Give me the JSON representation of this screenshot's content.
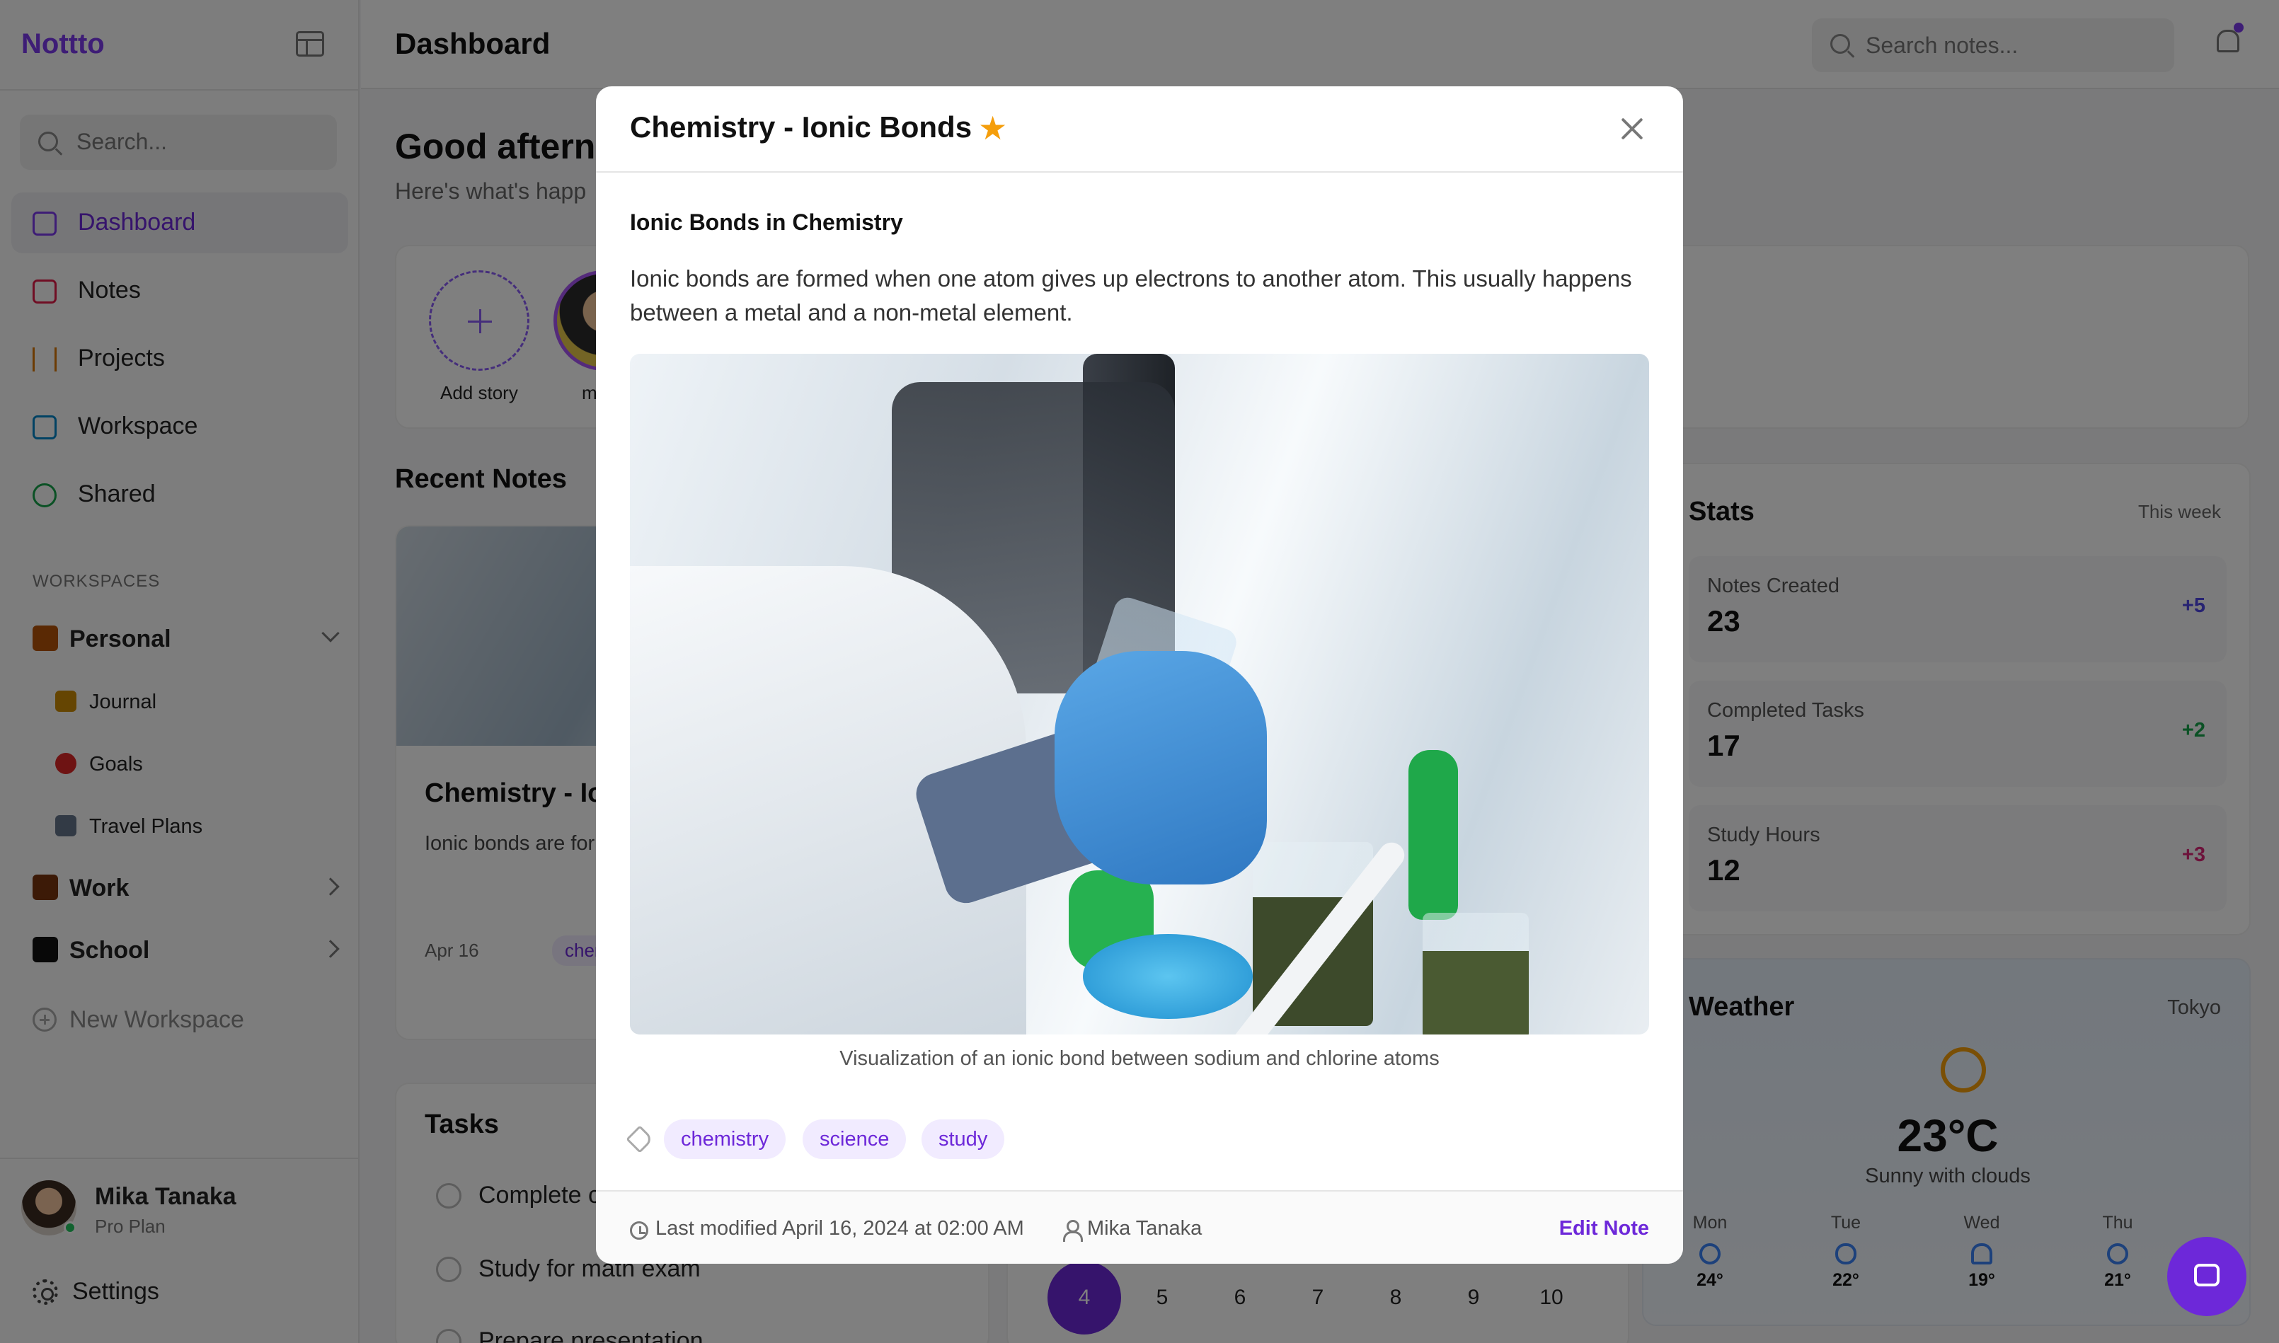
{
  "app": {
    "name": "Nottto"
  },
  "sidebar": {
    "search_placeholder": "Search...",
    "nav": [
      {
        "label": "Dashboard",
        "icon": "home-icon"
      },
      {
        "label": "Notes",
        "icon": "book-icon"
      },
      {
        "label": "Projects",
        "icon": "kanban-icon"
      },
      {
        "label": "Workspace",
        "icon": "folder-icon"
      },
      {
        "label": "Shared",
        "icon": "users-icon"
      }
    ],
    "workspaces_label": "WORKSPACES",
    "workspaces": [
      {
        "label": "Personal",
        "icon": "house-emoji",
        "children": [
          {
            "label": "Journal",
            "icon": "notebook-emoji"
          },
          {
            "label": "Goals",
            "icon": "dart-emoji"
          },
          {
            "label": "Travel Plans",
            "icon": "airplane-emoji"
          }
        ]
      },
      {
        "label": "Work",
        "icon": "briefcase-emoji"
      },
      {
        "label": "School",
        "icon": "graduation-cap-emoji"
      }
    ],
    "new_workspace": "New Workspace",
    "user": {
      "name": "Mika Tanaka",
      "plan": "Pro Plan"
    },
    "settings": "Settings"
  },
  "header": {
    "title": "Dashboard",
    "search_placeholder": "Search notes..."
  },
  "dashboard": {
    "greeting": "Good afterno",
    "greeting_sub": "Here's what's happ",
    "stories": {
      "add_label": "Add story",
      "user_label": "mika"
    },
    "recent_notes_title": "Recent Notes",
    "note_card": {
      "title": "Chemistry - Io",
      "body": "Ionic bonds are for atom gives up elec atom. This usually",
      "date": "Apr 16",
      "tag": "chem"
    },
    "tasks_title": "Tasks",
    "tasks": [
      "Complete c",
      "Study for math exam",
      "Prepare presentation"
    ],
    "calendar_days": [
      "4",
      "5",
      "6",
      "7",
      "8",
      "9",
      "10"
    ],
    "stats": {
      "title": "Stats",
      "period": "This week",
      "items": [
        {
          "label": "Notes Created",
          "value": "23",
          "delta": "+5",
          "color": "#4f46e5"
        },
        {
          "label": "Completed Tasks",
          "value": "17",
          "delta": "+2",
          "color": "#16a34a"
        },
        {
          "label": "Study Hours",
          "value": "12",
          "delta": "+3",
          "color": "#db2777"
        }
      ]
    },
    "weather": {
      "title": "Weather",
      "city": "Tokyo",
      "temp": "23°C",
      "desc": "Sunny with clouds",
      "forecast": [
        {
          "day": "Mon",
          "temp": "24°",
          "icon": "sun-icon"
        },
        {
          "day": "Tue",
          "temp": "22°",
          "icon": "cloud-icon"
        },
        {
          "day": "Wed",
          "temp": "19°",
          "icon": "rain-icon"
        },
        {
          "day": "Thu",
          "temp": "21°",
          "icon": "sun-icon"
        }
      ]
    }
  },
  "modal": {
    "title": "Chemistry - Ionic Bonds",
    "star": "★",
    "heading": "Ionic Bonds in Chemistry",
    "paragraph": "Ionic bonds are formed when one atom gives up electrons to another atom. This usually happens between a metal and a non-metal element.",
    "caption": "Visualization of an ionic bond between sodium and chlorine atoms",
    "tags": [
      "chemistry",
      "science",
      "study"
    ],
    "modified": "Last modified April 16, 2024 at 02:00 AM",
    "author": "Mika Tanaka",
    "edit_label": "Edit Note"
  },
  "colors": {
    "accent": "#6d28d9",
    "star": "#f59e0b",
    "tag_bg": "#f1ebff"
  }
}
